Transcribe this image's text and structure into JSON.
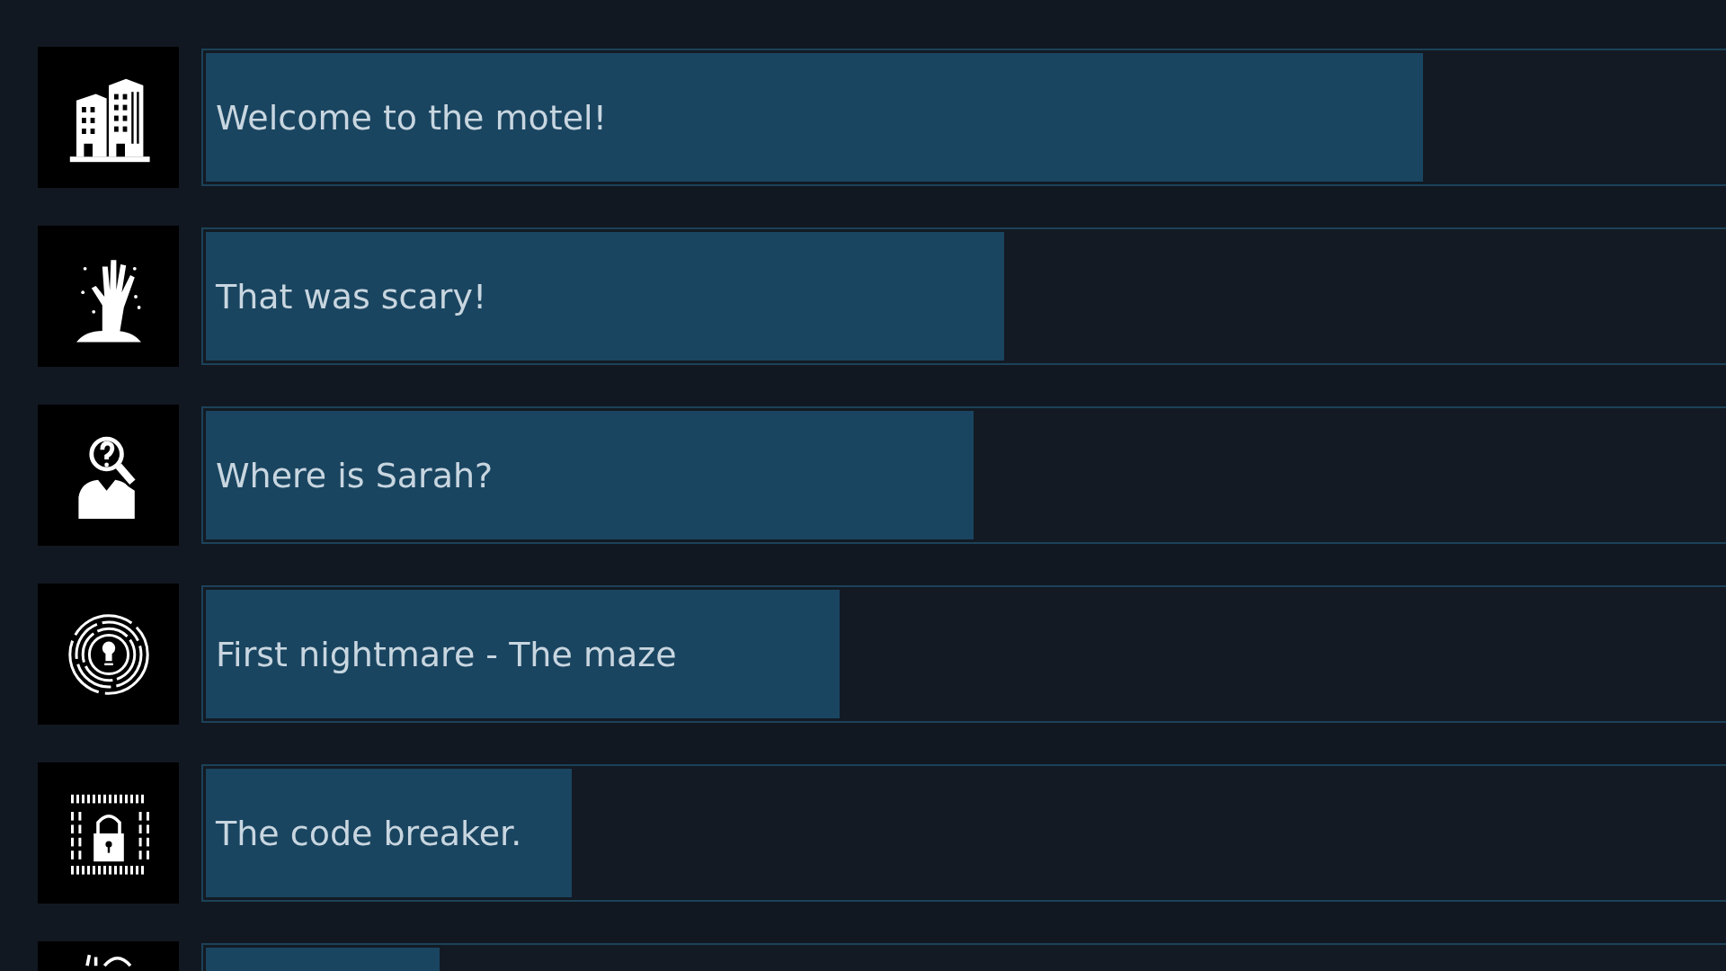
{
  "achievements": [
    {
      "title": "Welcome to the motel!",
      "level": 0.793
    },
    {
      "title": "That was scary!",
      "level": 0.52
    },
    {
      "title": "Where is Sarah?",
      "level": 0.5
    },
    {
      "title": "First nightmare - The maze",
      "level": 0.413
    },
    {
      "title": "The code breaker.",
      "level": 0.238
    },
    {
      "level": 0.152
    }
  ]
}
